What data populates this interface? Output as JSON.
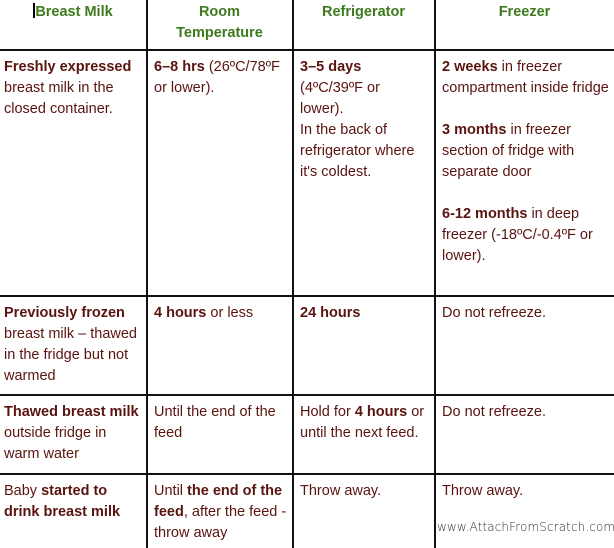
{
  "table": {
    "headers": [
      "Breast Milk",
      "Room Temperature",
      "Refrigerator",
      "Freezer"
    ],
    "header_room_line1": "Room",
    "header_room_line2": "Temperature",
    "rows": [
      {
        "milk": {
          "bold": "Freshly expressed",
          "rest": " breast milk in the closed container."
        },
        "room": {
          "bold": "6–8 hrs",
          "rest": " (26ºC/78ºF or lower)."
        },
        "fridge": {
          "bold": "3–5 days",
          "rest": " (4ºC/39ºF  or lower).",
          "extra": "In the back of refrigerator where it's coldest."
        },
        "freezer": [
          {
            "bold": "2 weeks",
            "rest": " in freezer compartment inside fridge"
          },
          {
            "bold": "3 months",
            "rest": " in freezer section of fridge with separate door"
          },
          {
            "bold": "6-12 months",
            "rest": " in deep freezer (-18ºC/-0.4ºF or lower)."
          }
        ]
      },
      {
        "milk": {
          "bold": "Previously frozen",
          "rest": " breast milk – thawed in the fridge but not warmed"
        },
        "room": {
          "bold": "4 hours",
          "rest": " or less"
        },
        "fridge": {
          "bold": "24 hours",
          "rest": ""
        },
        "freezer": {
          "text": "Do not refreeze."
        }
      },
      {
        "milk": {
          "bold": "Thawed breast milk",
          "rest": " outside fridge in warm water"
        },
        "room": {
          "text": "Until the end of the feed"
        },
        "fridge": {
          "pre": "Hold for ",
          "bold": "4 hours",
          "rest": " or until the next feed."
        },
        "freezer": {
          "text": "Do not refreeze."
        }
      },
      {
        "milk": {
          "pre": "Baby ",
          "bold": "started to drink breast milk",
          "rest": ""
        },
        "room": {
          "pre": "Until ",
          "bold": "the end of the feed",
          "rest": ", after the feed - throw away"
        },
        "fridge": {
          "text": "Throw away."
        },
        "freezer": {
          "text": "Throw away."
        }
      }
    ]
  },
  "watermark": "www.AttachFromScratch.com",
  "colors": {
    "header_text": "#3d7a1e",
    "body_text": "#5a1410",
    "grid": "#111111"
  }
}
